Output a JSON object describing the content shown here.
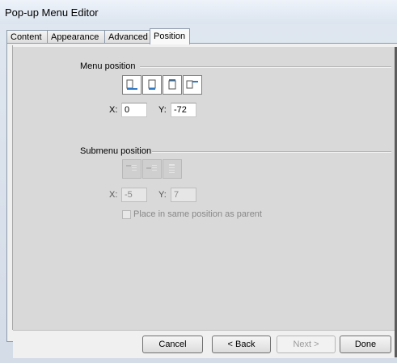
{
  "window": {
    "title": "Pop-up Menu Editor"
  },
  "tabs": [
    {
      "label": "Content"
    },
    {
      "label": "Appearance"
    },
    {
      "label": "Advanced"
    },
    {
      "label": "Position",
      "active": true
    }
  ],
  "menu_position": {
    "label": "Menu position",
    "buttons": [
      {
        "icon": "menu-bottom-left-icon"
      },
      {
        "icon": "menu-below-icon"
      },
      {
        "icon": "menu-above-icon"
      },
      {
        "icon": "menu-right-top-icon"
      }
    ],
    "x_label": "X:",
    "x_value": "0",
    "y_label": "Y:",
    "y_value": "-72"
  },
  "submenu_position": {
    "label": "Submenu position",
    "buttons": [
      {
        "icon": "submenu-top-left-icon",
        "enabled": false
      },
      {
        "icon": "submenu-middle-icon",
        "enabled": false
      },
      {
        "icon": "submenu-bottom-icon",
        "enabled": false
      }
    ],
    "x_label": "X:",
    "x_value": "-5",
    "y_label": "Y:",
    "y_value": "7",
    "same_position_label": "Place in same position as parent",
    "same_position_checked": false
  },
  "footer": {
    "cancel_label": "Cancel",
    "back_label": "< Back",
    "next_label": "Next >",
    "done_label": "Done"
  },
  "colors": {
    "panel": "#d9d9d9",
    "icon_accent": "#2e78c4"
  }
}
